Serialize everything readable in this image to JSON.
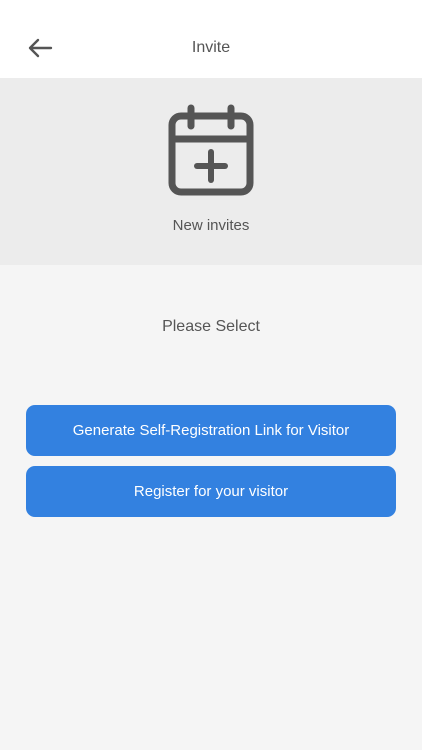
{
  "header": {
    "title": "Invite",
    "back_icon": "arrow-left-icon"
  },
  "hero": {
    "icon": "calendar-plus-icon",
    "label": "New invites"
  },
  "main": {
    "prompt": "Please Select",
    "buttons": [
      {
        "label": "Generate Self-Registration Link for Visitor"
      },
      {
        "label": "Register for your visitor"
      }
    ]
  },
  "colors": {
    "primary": "#3381e0",
    "header_bg": "#ffffff",
    "hero_bg": "#ececec",
    "page_bg": "#f5f5f5",
    "text": "#555555"
  }
}
